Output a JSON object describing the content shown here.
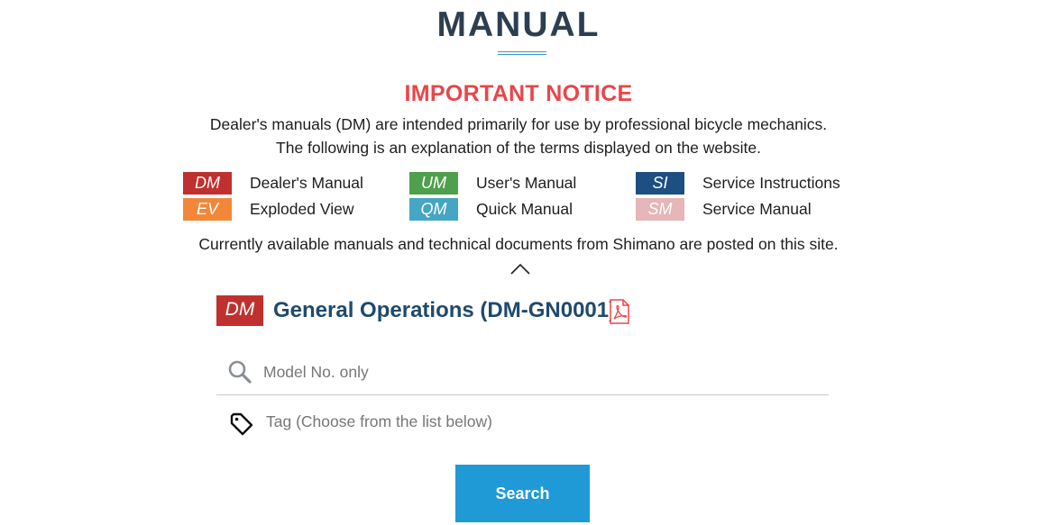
{
  "page": {
    "title": "MANUAL"
  },
  "notice": {
    "title": "IMPORTANT NOTICE",
    "line1": "Dealer's manuals (DM) are intended primarily for use by professional bicycle mechanics.",
    "line2": "The following is an explanation of the terms displayed on the website.",
    "available": "Currently available manuals and technical documents from Shimano are posted on this site."
  },
  "legend": [
    {
      "code": "DM",
      "label": "Dealer's Manual",
      "color": "#c0302e"
    },
    {
      "code": "UM",
      "label": "User's Manual",
      "color": "#4ea04c"
    },
    {
      "code": "SI",
      "label": "Service Instructions",
      "color": "#1d4f82"
    },
    {
      "code": "EV",
      "label": "Exploded View",
      "color": "#f2873a"
    },
    {
      "code": "QM",
      "label": "Quick Manual",
      "color": "#44a6c4"
    },
    {
      "code": "SM",
      "label": "Service Manual",
      "color": "#e6b6b8"
    }
  ],
  "featured_manual": {
    "code": "DM",
    "title": "General Operations (DM-GN0001)",
    "file_icon": "pdf-icon"
  },
  "search": {
    "placeholder": "Model No. only",
    "value": "",
    "icon": "search-icon"
  },
  "tag": {
    "label": "Tag (Choose from the list below)",
    "icon": "tag-icon"
  },
  "search_button": {
    "label": "Search",
    "color": "#1f9ad6"
  },
  "colors": {
    "title": "#2d3e50",
    "notice": "#e8464a",
    "manual_title": "#1f4a6d",
    "accent_line": "#3a97b5"
  }
}
